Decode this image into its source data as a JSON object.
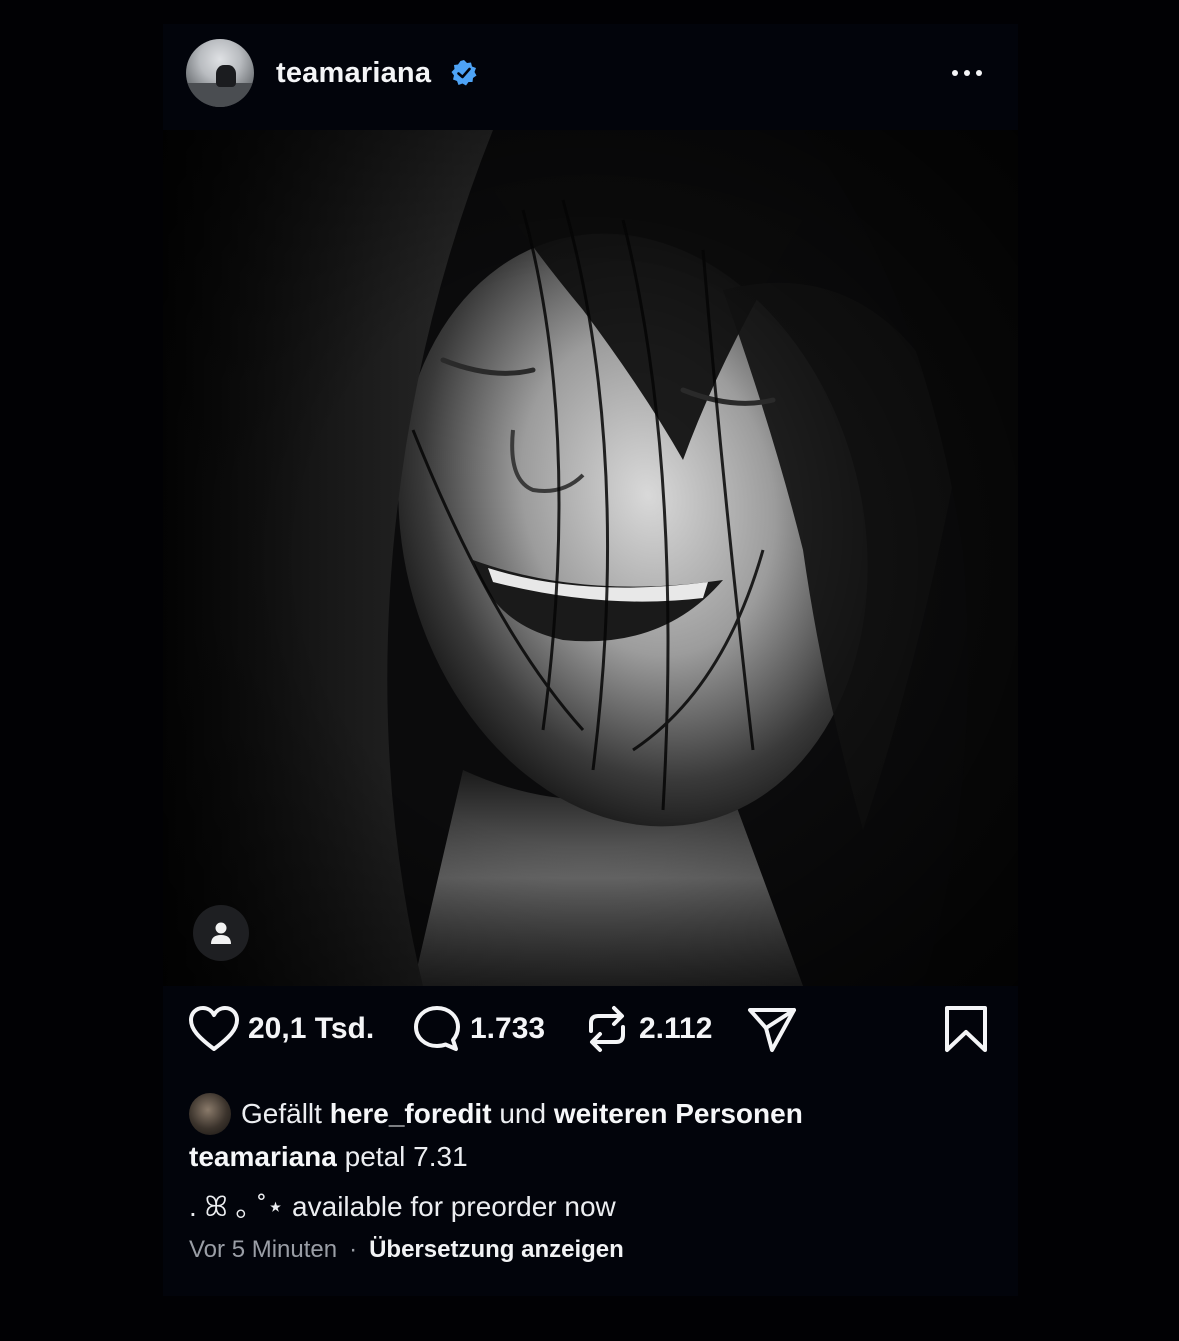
{
  "post": {
    "username": "teamariana",
    "verified": true,
    "more_icon": "more-horizontal-icon"
  },
  "actions": {
    "likes": "20,1 Tsd.",
    "comments": "1.733",
    "reposts": "2.112"
  },
  "liked_by": {
    "prefix": "Gefällt",
    "user": "here_foredit",
    "connector": "und",
    "suffix": "weiteren Personen"
  },
  "caption": {
    "author": "teamariana",
    "text": "petal 7.31",
    "line2": ". ꕤ ｡ ˚⋆ available for preorder now"
  },
  "meta": {
    "time": "Vor 5 Minuten",
    "separator": "·",
    "translate": "Übersetzung anzeigen"
  },
  "colors": {
    "background": "#010104",
    "card": "#02040b",
    "verified_badge": "#4ea3f5",
    "text": "#f4f5f7",
    "muted": "#9a9ea6"
  }
}
